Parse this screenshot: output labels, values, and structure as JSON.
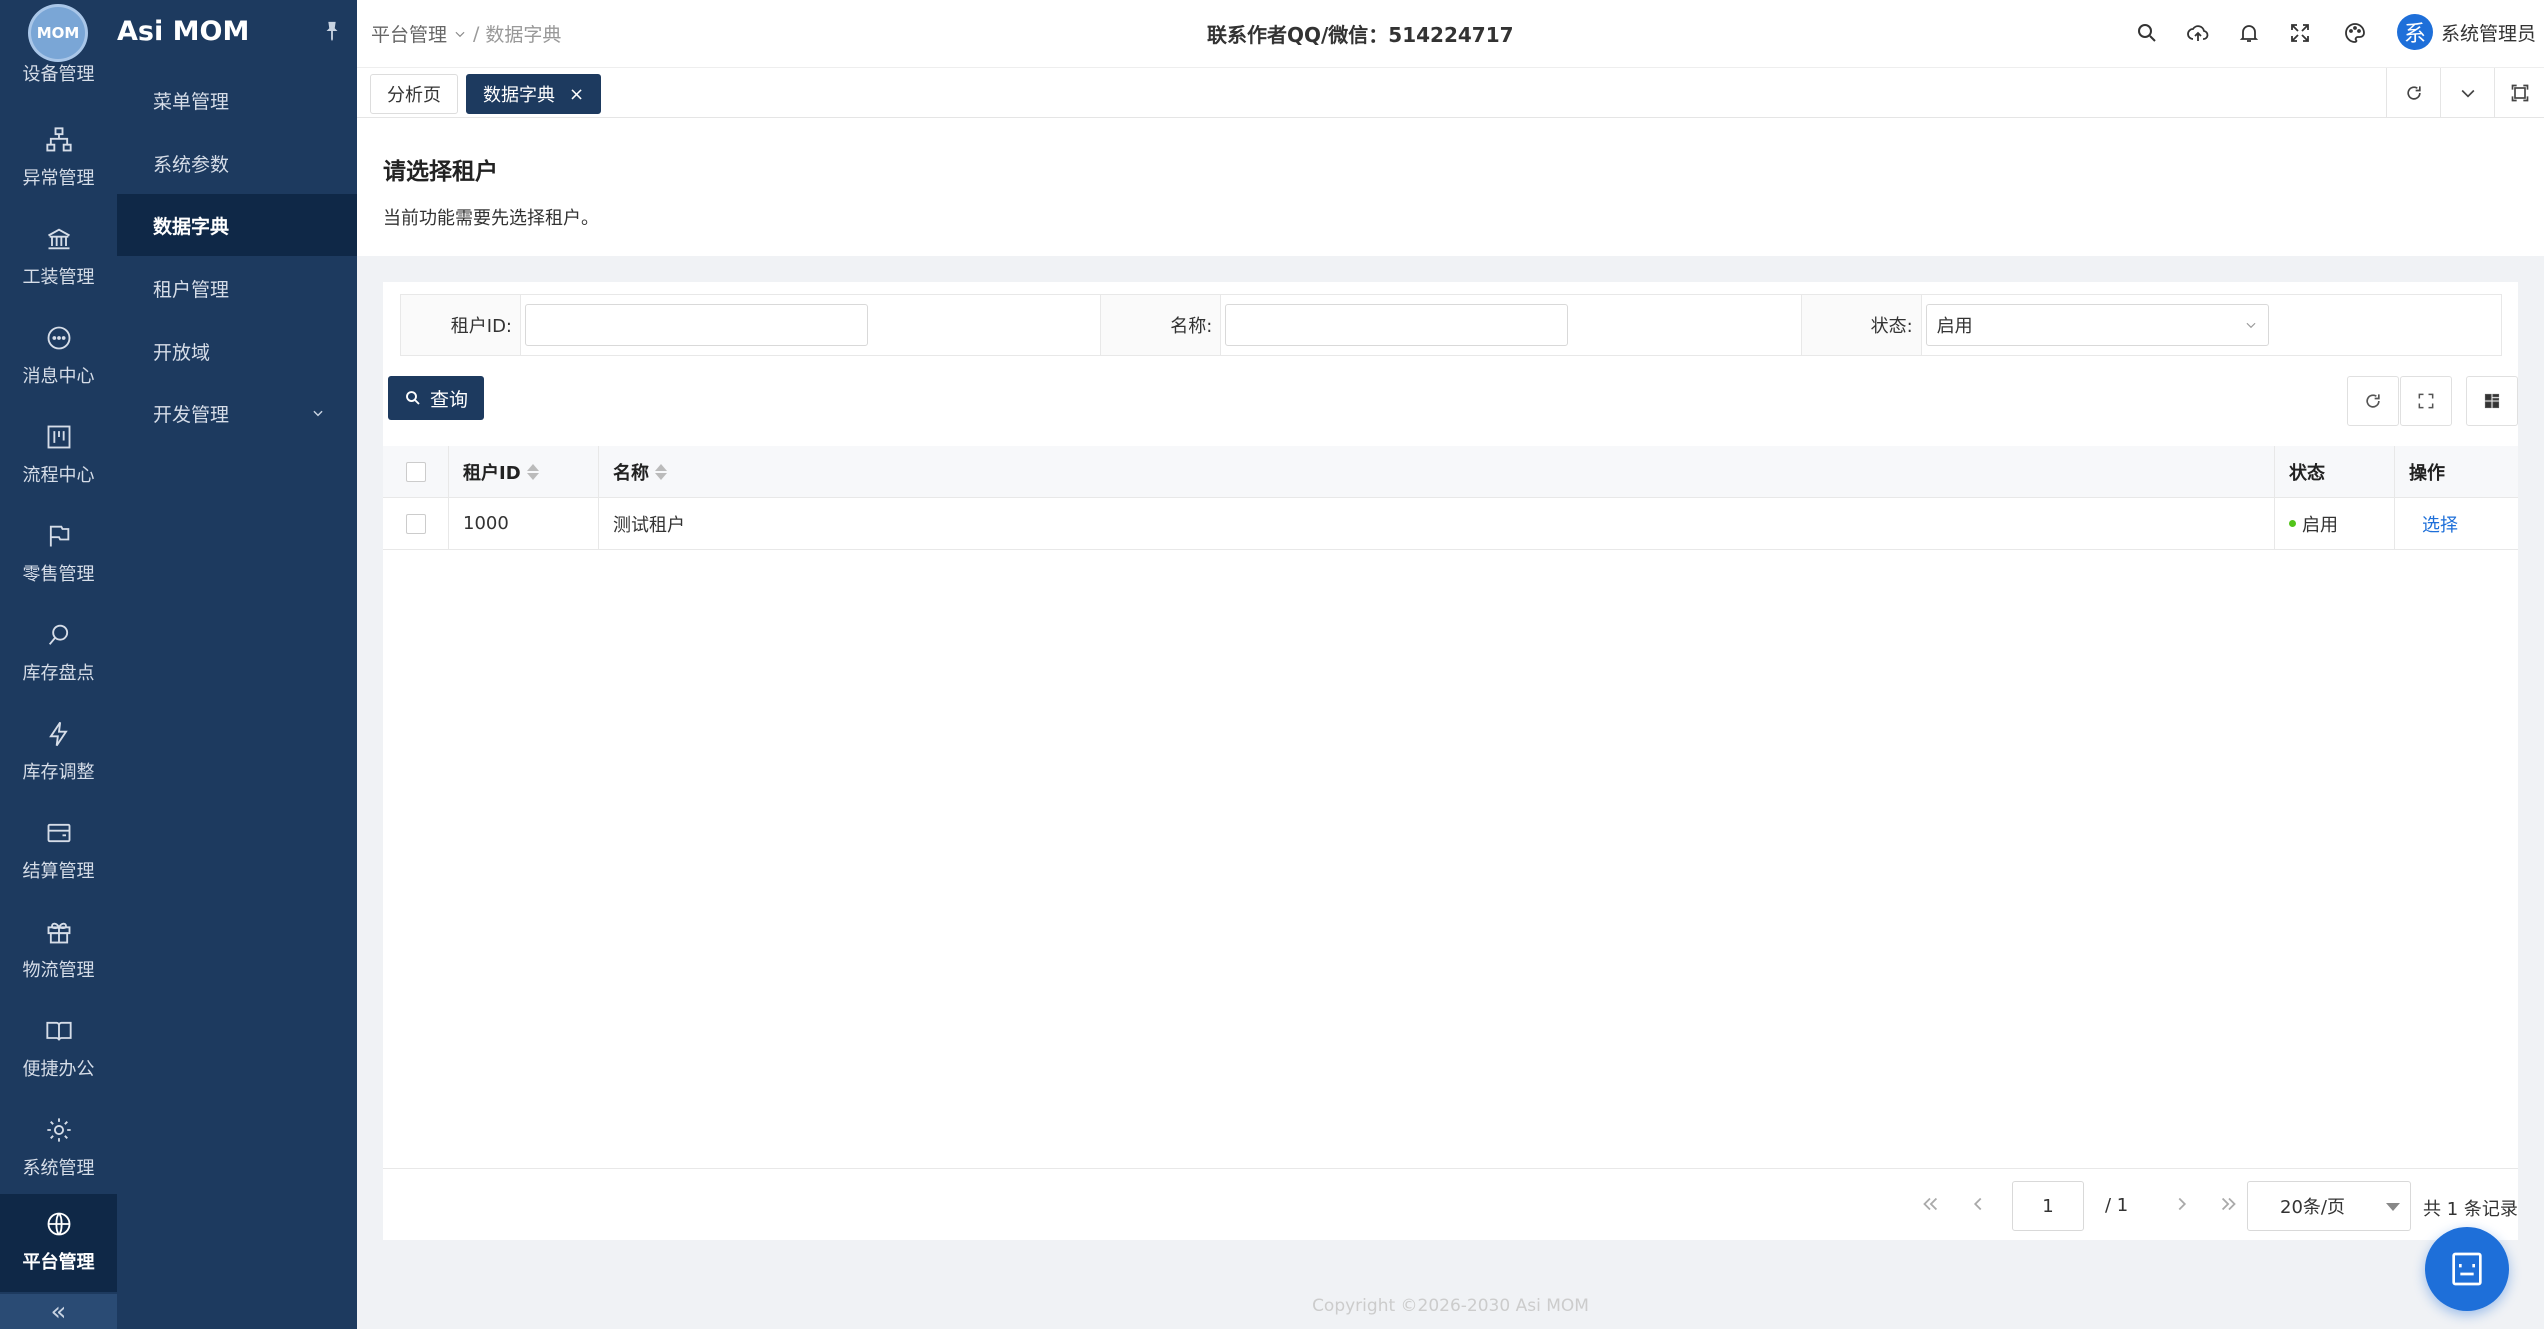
{
  "app": {
    "logo_text": "MOM",
    "brand": "Asi MOM"
  },
  "rail": {
    "items": [
      {
        "label": "设备管理",
        "icon": "device-icon"
      },
      {
        "label": "异常管理",
        "icon": "hierarchy-icon"
      },
      {
        "label": "工装管理",
        "icon": "bank-icon"
      },
      {
        "label": "消息中心",
        "icon": "chat-icon"
      },
      {
        "label": "流程中心",
        "icon": "flow-icon"
      },
      {
        "label": "零售管理",
        "icon": "flag-icon"
      },
      {
        "label": "库存盘点",
        "icon": "search-icon"
      },
      {
        "label": "库存调整",
        "icon": "lightning-icon"
      },
      {
        "label": "结算管理",
        "icon": "wallet-icon"
      },
      {
        "label": "物流管理",
        "icon": "gift-icon"
      },
      {
        "label": "便捷办公",
        "icon": "book-icon"
      },
      {
        "label": "系统管理",
        "icon": "gear-icon"
      },
      {
        "label": "平台管理",
        "icon": "globe-icon"
      }
    ],
    "collapse": "«"
  },
  "menu": {
    "items": [
      {
        "label": "菜单管理"
      },
      {
        "label": "系统参数"
      },
      {
        "label": "数据字典"
      },
      {
        "label": "租户管理"
      },
      {
        "label": "开放域"
      },
      {
        "label": "开发管理"
      }
    ]
  },
  "header": {
    "breadcrumb": [
      "平台管理",
      "数据字典"
    ],
    "breadcrumb_sep": "/",
    "contact": "联系作者QQ/微信：514224717",
    "user_avatar": "系",
    "user_name": "系统管理员"
  },
  "tabs": [
    {
      "label": "分析页"
    },
    {
      "label": "数据字典"
    }
  ],
  "tab_close": "×",
  "notice": {
    "title": "请选择租户",
    "desc": "当前功能需要先选择租户。"
  },
  "filter": {
    "tenant_id_label": "租户ID:",
    "tenant_id_value": "",
    "name_label": "名称:",
    "name_value": "",
    "status_label": "状态:",
    "status_value": "启用"
  },
  "toolbar": {
    "query_label": "查询"
  },
  "table": {
    "headers": {
      "id": "租户ID",
      "name": "名称",
      "status": "状态",
      "op": "操作"
    },
    "rows": [
      {
        "id": "1000",
        "name": "测试租户",
        "status": "启用",
        "op": "选择"
      }
    ]
  },
  "pager": {
    "page": "1",
    "total_pages": "/ 1",
    "page_size": "20条/页",
    "record_count": "共 1 条记录"
  },
  "footer": "Copyright ©2026-2030 Asi MOM",
  "colors": {
    "sidebar": "#1d3a5f",
    "sidebar_active": "#0f2847",
    "accent": "#1e6fd9",
    "status_ok": "#52c41a"
  }
}
